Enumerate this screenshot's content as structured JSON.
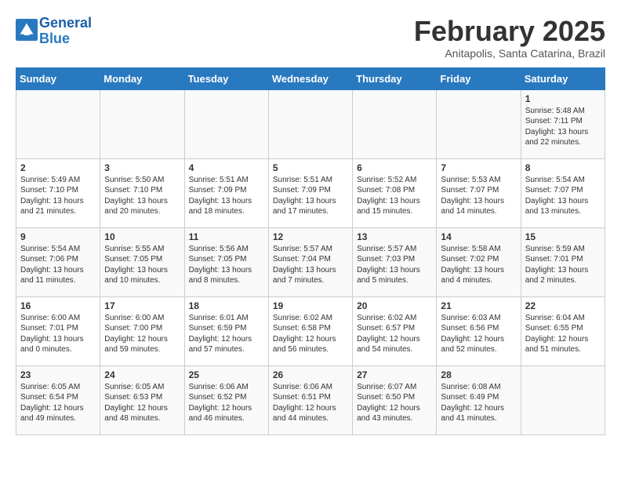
{
  "header": {
    "logo_line1": "General",
    "logo_line2": "Blue",
    "month": "February 2025",
    "location": "Anitapolis, Santa Catarina, Brazil"
  },
  "days_of_week": [
    "Sunday",
    "Monday",
    "Tuesday",
    "Wednesday",
    "Thursday",
    "Friday",
    "Saturday"
  ],
  "weeks": [
    {
      "days": [
        {
          "num": "",
          "text": ""
        },
        {
          "num": "",
          "text": ""
        },
        {
          "num": "",
          "text": ""
        },
        {
          "num": "",
          "text": ""
        },
        {
          "num": "",
          "text": ""
        },
        {
          "num": "",
          "text": ""
        },
        {
          "num": "1",
          "text": "Sunrise: 5:48 AM\nSunset: 7:11 PM\nDaylight: 13 hours\nand 22 minutes."
        }
      ]
    },
    {
      "days": [
        {
          "num": "2",
          "text": "Sunrise: 5:49 AM\nSunset: 7:10 PM\nDaylight: 13 hours\nand 21 minutes."
        },
        {
          "num": "3",
          "text": "Sunrise: 5:50 AM\nSunset: 7:10 PM\nDaylight: 13 hours\nand 20 minutes."
        },
        {
          "num": "4",
          "text": "Sunrise: 5:51 AM\nSunset: 7:09 PM\nDaylight: 13 hours\nand 18 minutes."
        },
        {
          "num": "5",
          "text": "Sunrise: 5:51 AM\nSunset: 7:09 PM\nDaylight: 13 hours\nand 17 minutes."
        },
        {
          "num": "6",
          "text": "Sunrise: 5:52 AM\nSunset: 7:08 PM\nDaylight: 13 hours\nand 15 minutes."
        },
        {
          "num": "7",
          "text": "Sunrise: 5:53 AM\nSunset: 7:07 PM\nDaylight: 13 hours\nand 14 minutes."
        },
        {
          "num": "8",
          "text": "Sunrise: 5:54 AM\nSunset: 7:07 PM\nDaylight: 13 hours\nand 13 minutes."
        }
      ]
    },
    {
      "days": [
        {
          "num": "9",
          "text": "Sunrise: 5:54 AM\nSunset: 7:06 PM\nDaylight: 13 hours\nand 11 minutes."
        },
        {
          "num": "10",
          "text": "Sunrise: 5:55 AM\nSunset: 7:05 PM\nDaylight: 13 hours\nand 10 minutes."
        },
        {
          "num": "11",
          "text": "Sunrise: 5:56 AM\nSunset: 7:05 PM\nDaylight: 13 hours\nand 8 minutes."
        },
        {
          "num": "12",
          "text": "Sunrise: 5:57 AM\nSunset: 7:04 PM\nDaylight: 13 hours\nand 7 minutes."
        },
        {
          "num": "13",
          "text": "Sunrise: 5:57 AM\nSunset: 7:03 PM\nDaylight: 13 hours\nand 5 minutes."
        },
        {
          "num": "14",
          "text": "Sunrise: 5:58 AM\nSunset: 7:02 PM\nDaylight: 13 hours\nand 4 minutes."
        },
        {
          "num": "15",
          "text": "Sunrise: 5:59 AM\nSunset: 7:01 PM\nDaylight: 13 hours\nand 2 minutes."
        }
      ]
    },
    {
      "days": [
        {
          "num": "16",
          "text": "Sunrise: 6:00 AM\nSunset: 7:01 PM\nDaylight: 13 hours\nand 0 minutes."
        },
        {
          "num": "17",
          "text": "Sunrise: 6:00 AM\nSunset: 7:00 PM\nDaylight: 12 hours\nand 59 minutes."
        },
        {
          "num": "18",
          "text": "Sunrise: 6:01 AM\nSunset: 6:59 PM\nDaylight: 12 hours\nand 57 minutes."
        },
        {
          "num": "19",
          "text": "Sunrise: 6:02 AM\nSunset: 6:58 PM\nDaylight: 12 hours\nand 56 minutes."
        },
        {
          "num": "20",
          "text": "Sunrise: 6:02 AM\nSunset: 6:57 PM\nDaylight: 12 hours\nand 54 minutes."
        },
        {
          "num": "21",
          "text": "Sunrise: 6:03 AM\nSunset: 6:56 PM\nDaylight: 12 hours\nand 52 minutes."
        },
        {
          "num": "22",
          "text": "Sunrise: 6:04 AM\nSunset: 6:55 PM\nDaylight: 12 hours\nand 51 minutes."
        }
      ]
    },
    {
      "days": [
        {
          "num": "23",
          "text": "Sunrise: 6:05 AM\nSunset: 6:54 PM\nDaylight: 12 hours\nand 49 minutes."
        },
        {
          "num": "24",
          "text": "Sunrise: 6:05 AM\nSunset: 6:53 PM\nDaylight: 12 hours\nand 48 minutes."
        },
        {
          "num": "25",
          "text": "Sunrise: 6:06 AM\nSunset: 6:52 PM\nDaylight: 12 hours\nand 46 minutes."
        },
        {
          "num": "26",
          "text": "Sunrise: 6:06 AM\nSunset: 6:51 PM\nDaylight: 12 hours\nand 44 minutes."
        },
        {
          "num": "27",
          "text": "Sunrise: 6:07 AM\nSunset: 6:50 PM\nDaylight: 12 hours\nand 43 minutes."
        },
        {
          "num": "28",
          "text": "Sunrise: 6:08 AM\nSunset: 6:49 PM\nDaylight: 12 hours\nand 41 minutes."
        },
        {
          "num": "",
          "text": ""
        }
      ]
    }
  ]
}
